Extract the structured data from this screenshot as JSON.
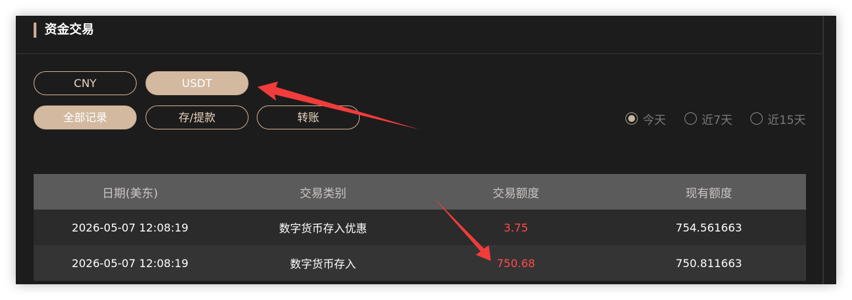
{
  "header": {
    "title": "资金交易"
  },
  "currency_tabs": [
    {
      "label": "CNY",
      "active": false
    },
    {
      "label": "USDT",
      "active": true
    }
  ],
  "record_tabs": [
    {
      "label": "全部记录",
      "active": true
    },
    {
      "label": "存/提款",
      "active": false
    },
    {
      "label": "转账",
      "active": false
    }
  ],
  "date_filter": [
    {
      "label": "今天",
      "checked": true
    },
    {
      "label": "近7天",
      "checked": false
    },
    {
      "label": "近15天",
      "checked": false
    }
  ],
  "table": {
    "columns": [
      "日期(美东)",
      "交易类别",
      "交易额度",
      "现有额度"
    ],
    "rows": [
      {
        "date": "2026-05-07 12:08:19",
        "type": "数字货币存入优惠",
        "amount": "3.75",
        "balance": "754.561663"
      },
      {
        "date": "2026-05-07 12:08:19",
        "type": "数字货币存入",
        "amount": "750.68",
        "balance": "750.811663"
      }
    ]
  },
  "colors": {
    "background": "#1d1c1c",
    "accent": "#d2b9a0",
    "amount_red": "#ff4a4a",
    "annotation_arrow": "#f23c3c"
  }
}
